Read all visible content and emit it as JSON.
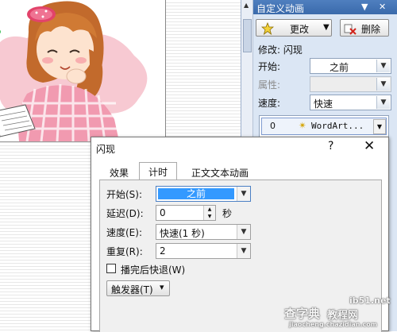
{
  "pane": {
    "title": "自定义动画",
    "change_label": "更改",
    "delete_label": "删除",
    "modify_label": "修改: 闪现",
    "start_label": "开始:",
    "start_value": "之前",
    "property_label": "属性:",
    "speed_label": "速度:",
    "speed_value": "快速",
    "list_item": {
      "index": "0",
      "text": "WordArt..."
    }
  },
  "dialog": {
    "title": "闪现",
    "help": "?",
    "close": "✕",
    "tabs": [
      "效果",
      "计时",
      "正文文本动画"
    ],
    "active_tab": 1,
    "start_label": "开始(S):",
    "start_value": "之前",
    "delay_label": "延迟(D):",
    "delay_value": "0",
    "delay_unit": "秒",
    "speed_label": "速度(E):",
    "speed_value": "快速(1 秒)",
    "repeat_label": "重复(R):",
    "repeat_value": "2",
    "rewind_label": "播完后快退(W)",
    "rewind_checked": false,
    "trigger_label": "触发器(T)"
  },
  "watermark": {
    "brand": "查字典",
    "sub": "教程网",
    "site": "ib51.net",
    "url": "jiaocheng.chazidian.com"
  },
  "icons": {
    "change": "star-icon",
    "delete": "delete-icon",
    "dropdown": "chevron-down-icon",
    "trigger": "double-chevron-down-icon"
  }
}
